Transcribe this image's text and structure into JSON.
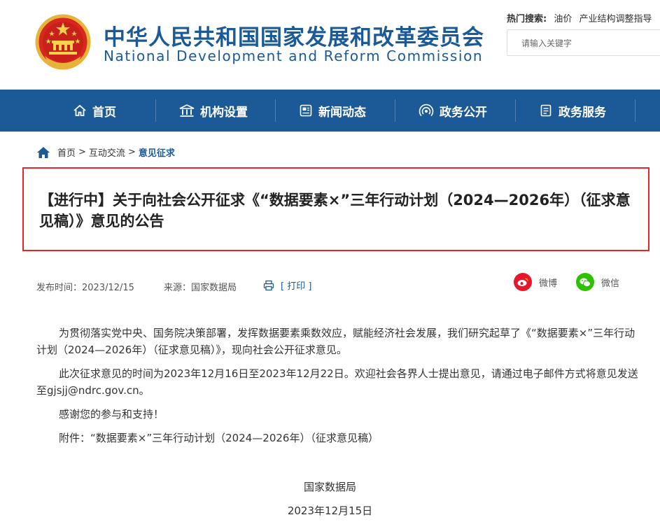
{
  "header": {
    "title_cn": "中华人民共和国国家发展和改革委员会",
    "title_en": "National Development and Reform Commission",
    "hot_label": "热门搜索:",
    "hot_keywords": [
      "油价",
      "产业结构调整指导"
    ],
    "search_placeholder": "请输入关键字"
  },
  "nav": {
    "items": [
      {
        "label": "首页",
        "icon": "home-icon"
      },
      {
        "label": "机构设置",
        "icon": "building-icon"
      },
      {
        "label": "新闻动态",
        "icon": "news-icon"
      },
      {
        "label": "政务公开",
        "icon": "broadcast-icon"
      },
      {
        "label": "政务服务",
        "icon": "document-icon"
      }
    ]
  },
  "breadcrumb": {
    "items": [
      "首页",
      "互动交流",
      "意见征求"
    ],
    "separator": ">"
  },
  "article": {
    "title": "【进行中】关于向社会公开征求《“数据要素×”三年行动计划（2024—2026年）（征求意见稿）》意见的公告",
    "publish_label": "发布时间：",
    "publish_date": "2023/12/15",
    "source_label": "来源：",
    "source": "国家数据局",
    "print_label": "[ 打印 ]",
    "share": {
      "weibo": "微博",
      "wechat": "微信"
    },
    "paragraphs": {
      "p1": "为贯彻落实党中央、国务院决策部署，发挥数据要素乘数效应，赋能经济社会发展，我们研究起草了《“数据要素×”三年行动计划（2024—2026年）（征求意见稿）》，现向社会公开征求意见。",
      "p2_before": "此次征求意见的时间为2023年12月16日至2023年12月22日。欢迎社会各界人士提出意见，请通过电子邮件方式将意见发送至",
      "p2_email": "gjsjj@ndrc.gov.cn",
      "p2_after": "。",
      "p3": "感谢您的参与和支持！",
      "p4": "附件：“数据要素×”三年行动计划（2024—2026年）（征求意见稿）"
    },
    "signature": "国家数据局",
    "date": "2023年12月15日"
  },
  "colors": {
    "brand_blue": "#1b5a96",
    "highlight_red": "#e8242a",
    "weibo": "#e6162d",
    "wechat": "#2dc100"
  }
}
